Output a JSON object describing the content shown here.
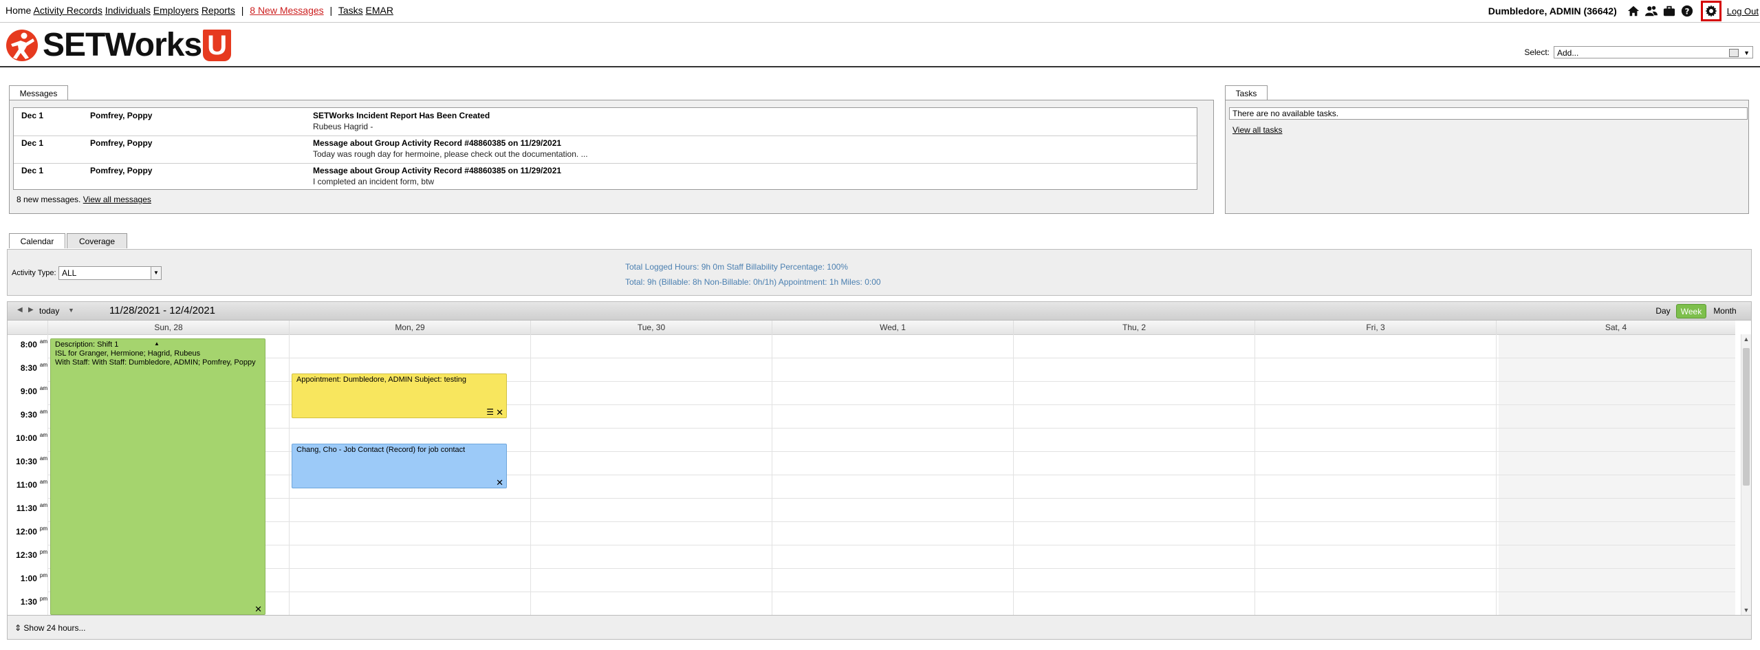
{
  "nav": {
    "home": "Home",
    "activity_records": "Activity Records",
    "individuals": "Individuals",
    "employers": "Employers",
    "reports": "Reports",
    "sep": "|",
    "new_messages": "8 New Messages",
    "tasks": "Tasks",
    "emar": "EMAR"
  },
  "user": {
    "name": "Dumbledore, ADMIN (36642)",
    "logout": "Log Out"
  },
  "icons": [
    "home-icon",
    "users-icon",
    "briefcase-icon",
    "help-icon",
    "gear-icon"
  ],
  "logo": {
    "text": "SETWorks",
    "u": "U"
  },
  "select": {
    "label": "Select:",
    "value": "Add..."
  },
  "messages": {
    "tab": "Messages",
    "rows": [
      {
        "date": "Dec 1",
        "from": "Pomfrey, Poppy",
        "subject": "SETWorks Incident Report Has Been Created",
        "body": "Rubeus Hagrid -"
      },
      {
        "date": "Dec 1",
        "from": "Pomfrey, Poppy",
        "subject": "Message about Group Activity Record #48860385 on 11/29/2021",
        "body": "Today was rough day for hermoine, please check out the documentation. ..."
      },
      {
        "date": "Dec 1",
        "from": "Pomfrey, Poppy",
        "subject": "Message about Group Activity Record #48860385 on 11/29/2021",
        "body": "I completed an incident form, btw"
      }
    ],
    "footer_count": "8 new messages.",
    "view_all": "View all messages"
  },
  "tasks": {
    "tab": "Tasks",
    "empty": "There are no available tasks.",
    "view_all": "View all tasks"
  },
  "calendar": {
    "tab_calendar": "Calendar",
    "tab_coverage": "Coverage",
    "activity_type_label": "Activity Type:",
    "activity_type_value": "ALL",
    "totals_line1": "Total Logged Hours: 9h 0m   Staff Billability Percentage: 100%",
    "totals_line2": "Total: 9h  (Billable: 8h   Non-Billable: 0h/1h)   Appointment: 1h   Miles: 0:00",
    "today": "today",
    "date_range": "11/28/2021 - 12/4/2021",
    "views": {
      "day": "Day",
      "week": "Week",
      "month": "Month"
    },
    "days": [
      "Sun, 28",
      "Mon, 29",
      "Tue, 30",
      "Wed, 1",
      "Thu, 2",
      "Fri, 3",
      "Sat, 4"
    ],
    "times": [
      {
        "t": "8:00",
        "p": "am"
      },
      {
        "t": "8:30",
        "p": "am"
      },
      {
        "t": "9:00",
        "p": "am"
      },
      {
        "t": "9:30",
        "p": "am"
      },
      {
        "t": "10:00",
        "p": "am"
      },
      {
        "t": "10:30",
        "p": "am"
      },
      {
        "t": "11:00",
        "p": "am"
      },
      {
        "t": "11:30",
        "p": "am"
      },
      {
        "t": "12:00",
        "p": "pm"
      },
      {
        "t": "12:30",
        "p": "pm"
      },
      {
        "t": "1:00",
        "p": "pm"
      },
      {
        "t": "1:30",
        "p": "pm"
      }
    ],
    "events": {
      "shift": {
        "line1": "Description: Shift 1",
        "line2": "ISL for Granger, Hermione; Hagrid, Rubeus",
        "line3": "With Staff: With Staff: Dumbledore, ADMIN; Pomfrey, Poppy"
      },
      "appointment": "Appointment: Dumbledore, ADMIN Subject: testing",
      "job_contact": "Chang, Cho - Job Contact (Record) for job contact"
    },
    "show_24": "Show 24 hours..."
  },
  "colors": {
    "accent_red": "#d50000",
    "logo_red": "#e63a1f",
    "week_green": "#7dbf4c",
    "shift_green": "#a5d46e",
    "appt_yellow": "#f8e65e",
    "job_blue": "#9ccaf8",
    "totals_blue": "#4a7fb0"
  }
}
